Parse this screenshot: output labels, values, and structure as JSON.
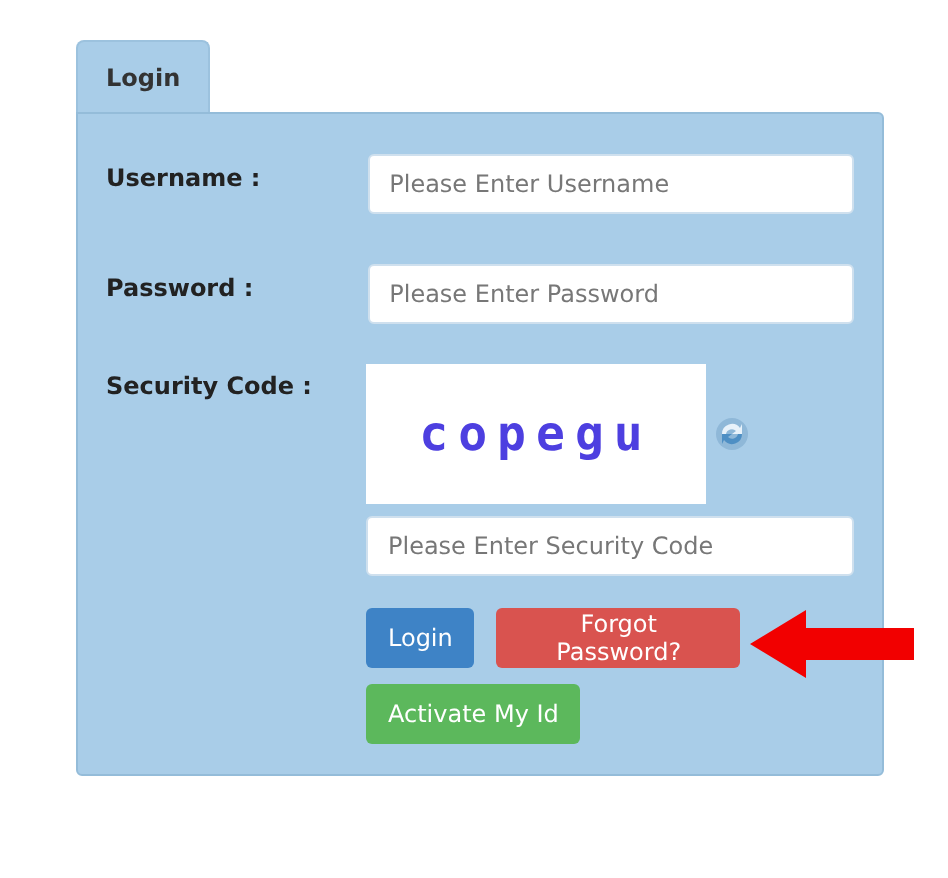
{
  "tabs": [
    {
      "label": "Login",
      "selected": true
    }
  ],
  "fields": [
    {
      "label": "Username :",
      "placeholder": "Please Enter Username"
    },
    {
      "label": "Password :",
      "placeholder": "Please Enter Password"
    }
  ],
  "security": {
    "label": "Security Code :",
    "captcha": "copegu",
    "placeholder": "Please Enter Security Code"
  },
  "buttons": [
    {
      "label": "Login",
      "kind": "primary"
    },
    {
      "label": "Forgot Password?",
      "kind": "danger"
    },
    {
      "label": "Activate My Id",
      "kind": "success"
    }
  ]
}
